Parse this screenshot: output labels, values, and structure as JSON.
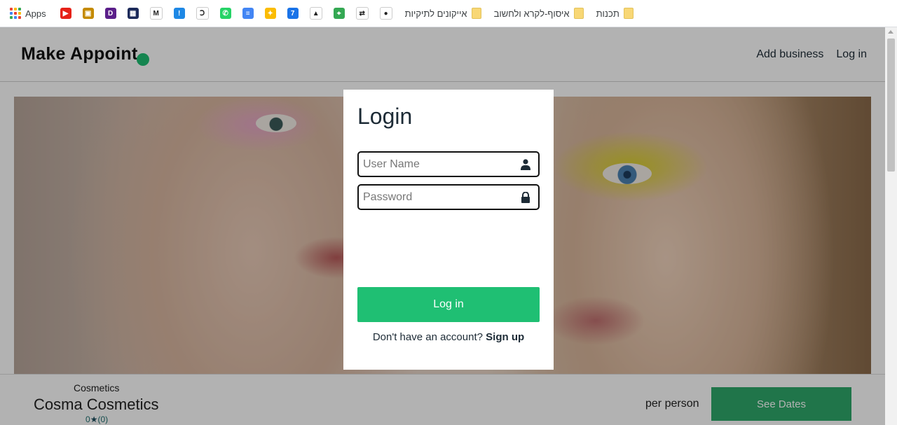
{
  "bookmarks": {
    "apps_label": "Apps",
    "favicons": [
      {
        "icon": "youtube-icon",
        "color": "#e62117",
        "glyph": "▶"
      },
      {
        "icon": "shop-icon",
        "color": "#c48a00",
        "glyph": "▣"
      },
      {
        "icon": "purple-d-icon",
        "color": "#5b1f8a",
        "glyph": "D"
      },
      {
        "icon": "dark-grid-icon",
        "color": "#1c2a5a",
        "glyph": "▦"
      },
      {
        "icon": "gmail-icon",
        "color": "#ffffff",
        "glyph": "M"
      },
      {
        "icon": "blue-exclaim-icon",
        "color": "#1e88e5",
        "glyph": "!"
      },
      {
        "icon": "black-r-icon",
        "color": "#ffffff",
        "glyph": "Ↄ"
      },
      {
        "icon": "whatsapp-icon",
        "color": "#25d366",
        "glyph": "✆"
      },
      {
        "icon": "google-docs-icon",
        "color": "#4285f4",
        "glyph": "≡"
      },
      {
        "icon": "google-keep-icon",
        "color": "#fbbc04",
        "glyph": "✦"
      },
      {
        "icon": "google-calendar-icon",
        "color": "#1a73e8",
        "glyph": "7"
      },
      {
        "icon": "google-drive-icon",
        "color": "#ffffff",
        "glyph": "▲"
      },
      {
        "icon": "google-maps-icon",
        "color": "#34a853",
        "glyph": "⌖"
      },
      {
        "icon": "israel-rail-icon",
        "color": "#ffffff",
        "glyph": "⇄"
      },
      {
        "icon": "github-icon",
        "color": "#ffffff",
        "glyph": "●"
      }
    ],
    "folders": [
      "אייקונים לתיקיות",
      "איסוף-לקרא ולחשוב",
      "תכנות"
    ]
  },
  "header": {
    "logo": "Make Appoint",
    "nav": [
      "Add business",
      "Log in"
    ]
  },
  "business": {
    "category": "Cosmetics",
    "name": "Cosma Cosmetics",
    "rating": "0",
    "reviews": "(0)",
    "price_label": "per person",
    "cta": "See Dates"
  },
  "login": {
    "title": "Login",
    "username_placeholder": "User Name",
    "password_placeholder": "Password",
    "submit": "Log in",
    "signup_prompt": "Don't have an account?",
    "signup_link": "Sign up"
  },
  "colors": {
    "accent": "#1fbf73",
    "text_dark": "#1d2b36"
  }
}
